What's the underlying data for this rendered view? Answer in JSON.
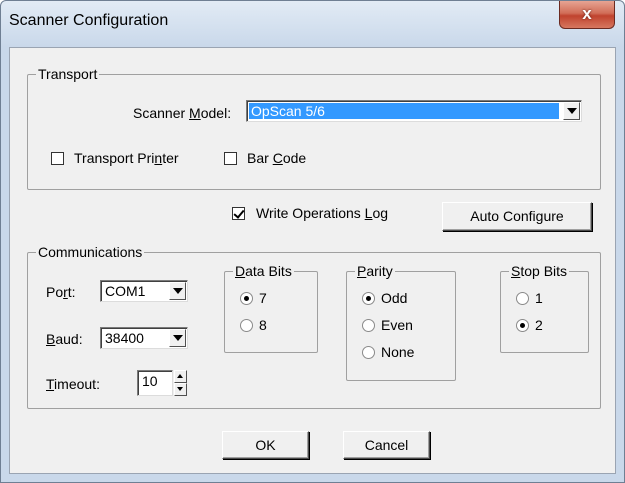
{
  "window": {
    "title": "Scanner Configuration",
    "close_glyph": "x"
  },
  "transport": {
    "legend": "Transport",
    "scanner_model_label": "Scanner Model:",
    "scanner_model_value": "OpScan 5/6",
    "transport_printer_label": "Transport Printer",
    "transport_printer_checked": false,
    "bar_code_label": "Bar Code",
    "bar_code_checked": false
  },
  "write_ops_log": {
    "label": "Write Operations Log",
    "checked": true
  },
  "auto_configure_label": "Auto Configure",
  "communications": {
    "legend": "Communications",
    "port_label": "Port:",
    "port_value": "COM1",
    "baud_label": "Baud:",
    "baud_value": "38400",
    "timeout_label": "Timeout:",
    "timeout_value": "10",
    "data_bits": {
      "legend": "Data Bits",
      "options": [
        "7",
        "8"
      ],
      "selected": "7"
    },
    "parity": {
      "legend": "Parity",
      "options": [
        "Odd",
        "Even",
        "None"
      ],
      "selected": "Odd"
    },
    "stop_bits": {
      "legend": "Stop Bits",
      "options": [
        "1",
        "2"
      ],
      "selected": "2"
    }
  },
  "buttons": {
    "ok": "OK",
    "cancel": "Cancel"
  },
  "colors": {
    "selection_highlight": "#3399ff",
    "close_button": "#c0432e",
    "dialog_face": "#f0f0f0"
  }
}
